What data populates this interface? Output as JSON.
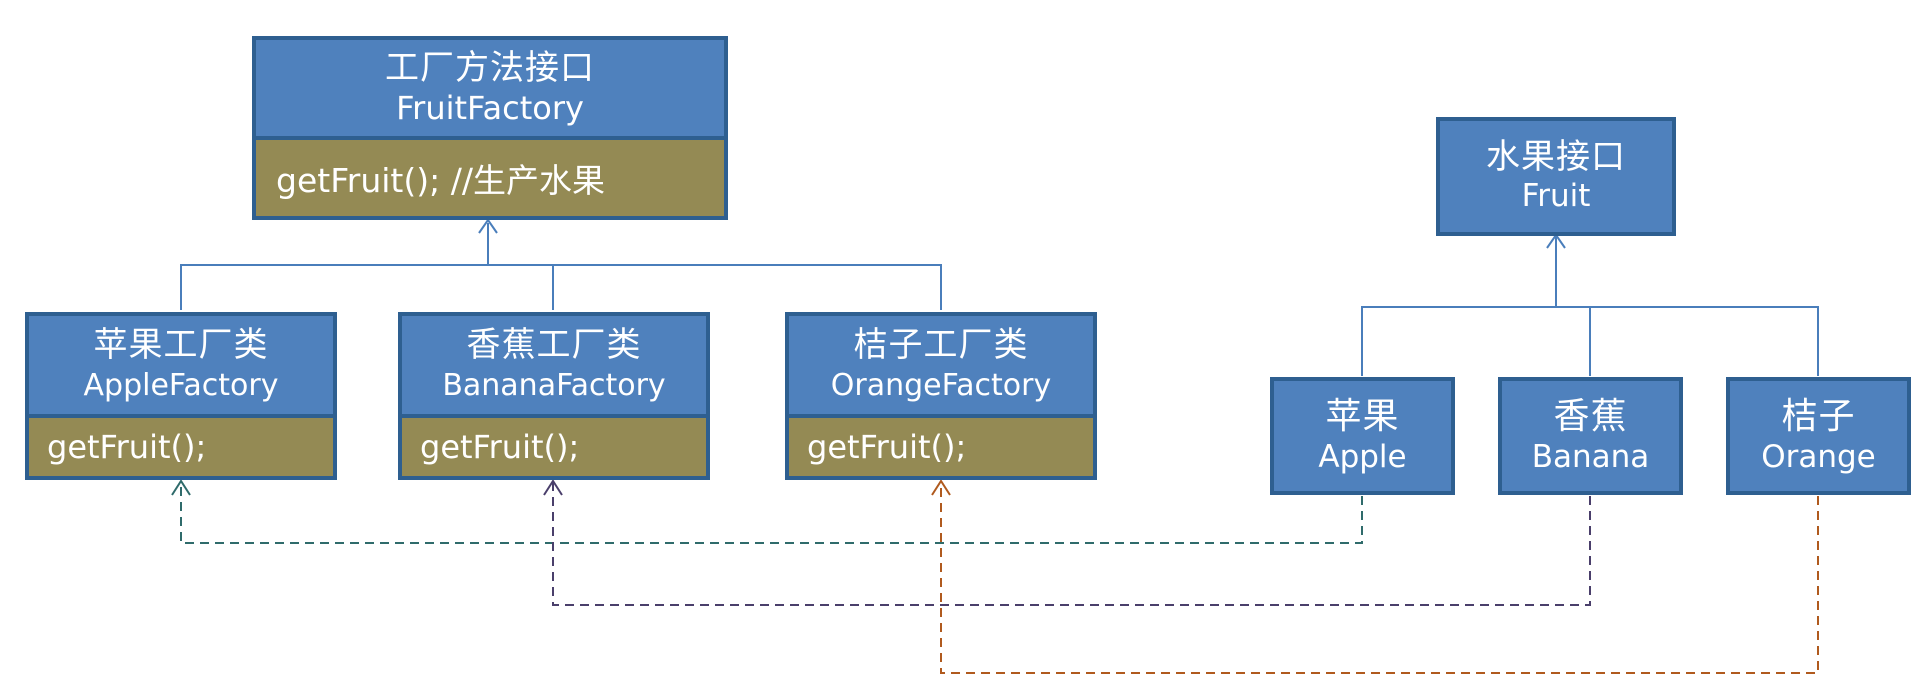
{
  "factory_interface": {
    "title_cn": "工厂方法接口",
    "title_en": "FruitFactory",
    "method": "getFruit(); //生产水果"
  },
  "factories": [
    {
      "title_cn": "苹果工厂类",
      "title_en": "AppleFactory",
      "method": "getFruit();"
    },
    {
      "title_cn": "香蕉工厂类",
      "title_en": "BananaFactory",
      "method": "getFruit();"
    },
    {
      "title_cn": "桔子工厂类",
      "title_en": "OrangeFactory",
      "method": "getFruit();"
    }
  ],
  "fruit_interface": {
    "title_cn": "水果接口",
    "title_en": "Fruit"
  },
  "fruits": [
    {
      "title_cn": "苹果",
      "title_en": "Apple"
    },
    {
      "title_cn": "香蕉",
      "title_en": "Banana"
    },
    {
      "title_cn": "桔子",
      "title_en": "Orange"
    }
  ],
  "colors": {
    "box_fill": "#4f81bd",
    "box_border": "#2e5f90",
    "method_fill": "#948a54",
    "inheritance_line": "#4a7ebb",
    "apple_dependency": "#2f6b6b",
    "banana_dependency": "#4a3f6b",
    "orange_dependency": "#b05a1e"
  }
}
